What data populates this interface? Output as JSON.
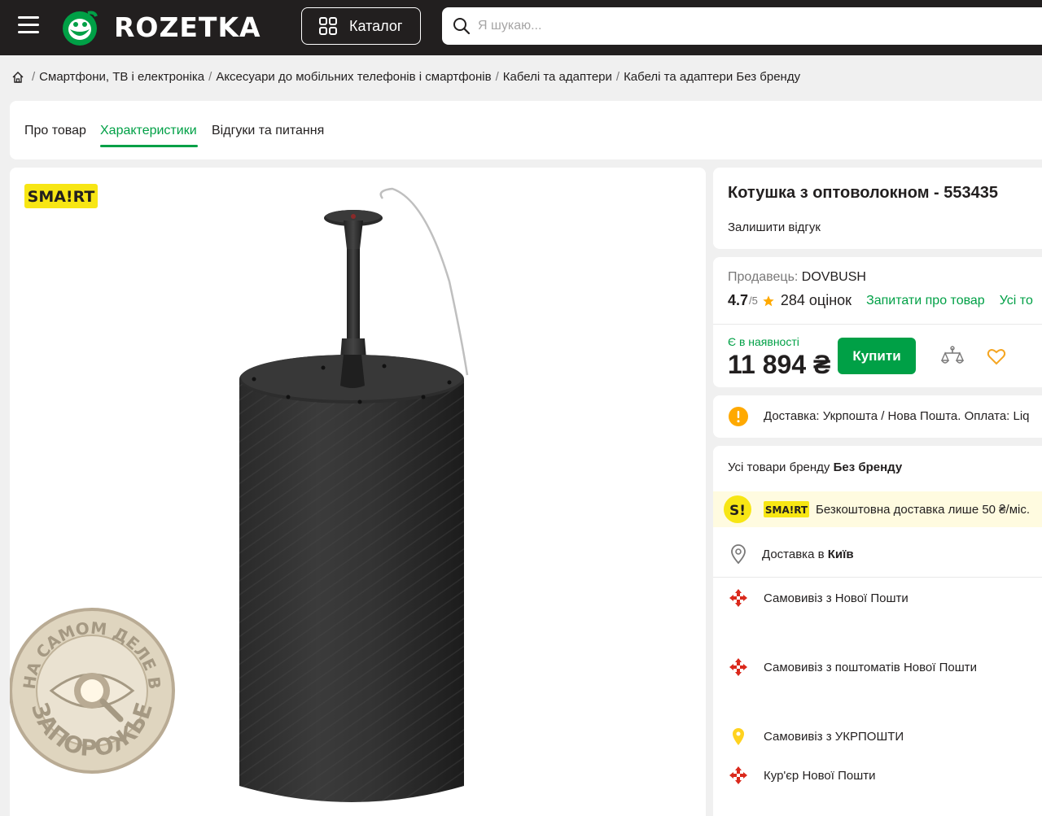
{
  "header": {
    "logo_text": "ROZETKA",
    "catalog_label": "Каталог",
    "search_placeholder": "Я шукаю..."
  },
  "breadcrumb": {
    "separator": "/",
    "items": [
      "Смартфони, ТВ і електроніка",
      "Аксесуари до мобільних телефонів і смартфонів",
      "Кабелі та адаптери",
      "Кабелі та адаптери Без бренду"
    ]
  },
  "tabs": [
    {
      "label": "Про товар",
      "active": false
    },
    {
      "label": "Характеристики",
      "active": true
    },
    {
      "label": "Відгуки та питання",
      "active": false
    }
  ],
  "image": {
    "smart_badge": "SMA!RT",
    "watermark_top": "НА САМОМ ДЕЛЕ В",
    "watermark_bottom": "ЗАПОРОЖЬЕ"
  },
  "product": {
    "title": "Котушка з оптоволокном - 553435",
    "leave_review": "Залишити відгук"
  },
  "seller": {
    "label": "Продавець:",
    "name": "DOVBUSH",
    "rating": "4.7",
    "rating_max": "/5",
    "rating_count": "284 оцінок",
    "ask_link": "Запитати про товар",
    "all_goods_link": "Усі то"
  },
  "purchase": {
    "status": "Є в наявності",
    "price": "11 894 ₴",
    "buy_label": "Купити"
  },
  "delivery_note": "Доставка: Укрпошта / Нова Пошта. Оплата: Liq",
  "brand": {
    "prefix": "Усі товари бренду",
    "name": "Без бренду"
  },
  "smart_promo": {
    "s_letter": "S!",
    "badge": "SMA!RT",
    "text": "Безкоштовна доставка лише 50 ₴/міс."
  },
  "delivery_city": {
    "prefix": "Доставка в",
    "city": "Київ"
  },
  "delivery_options": [
    "Самовивіз з Нової Пошти",
    "Самовивіз з поштоматів Нової Пошти",
    "Самовивіз з УКРПОШТИ",
    "Кур'єр Нової Пошти"
  ],
  "colors": {
    "header_bg": "#221f1f",
    "accent_green": "#00a046",
    "smart_yellow": "#f7e614",
    "star": "#ffa900"
  }
}
